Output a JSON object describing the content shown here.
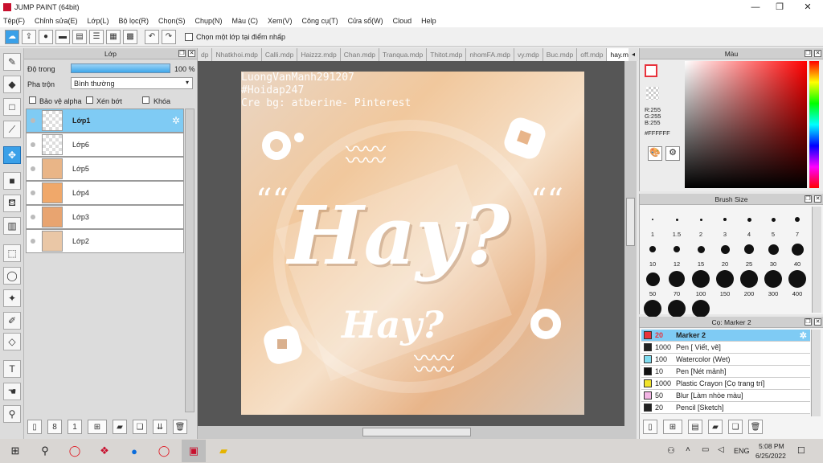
{
  "window": {
    "title": "JUMP PAINT (64bit)",
    "minimize": "—",
    "maximize": "❐",
    "close": "✕"
  },
  "menu": [
    "Tệp(F)",
    "Chỉnh sửa(E)",
    "Lớp(L)",
    "Bộ lọc(R)",
    "Chọn(S)",
    "Chụp(N)",
    "Màu (C)",
    "Xem(V)",
    "Công cụ(T)",
    "Cửa sổ(W)",
    "Cloud",
    "Help"
  ],
  "toolbar": {
    "checkbox_label": "Chọn một lớp tại điểm nhấp"
  },
  "layer_panel": {
    "title": "Lớp",
    "opacity_label": "Độ trong",
    "opacity_value": "100 %",
    "opacity_fraction": 1.0,
    "blend_label": "Pha trộn",
    "blend_value": "Bình thường",
    "protect_alpha": "Bảo vệ alpha",
    "clip": "Xén bớt",
    "lock": "Khóa",
    "layers": [
      {
        "name": "Lớp1",
        "selected": true
      },
      {
        "name": "Lớp6",
        "selected": false
      },
      {
        "name": "Lớp5",
        "selected": false
      },
      {
        "name": "Lớp4",
        "selected": false
      },
      {
        "name": "Lớp3",
        "selected": false
      },
      {
        "name": "Lớp2",
        "selected": false
      }
    ]
  },
  "tabs": [
    "dp",
    "Nhatkhoi.mdp",
    "Calli.mdp",
    "Haizzz.mdp",
    "Chan.mdp",
    "Tranqua.mdp",
    "Thitot.mdp",
    "nhomFA.mdp",
    "vy.mdp",
    "Buc.mdp",
    "off.mdp",
    "hay.mdp"
  ],
  "canvas": {
    "credit_lines": [
      "LuongVanManh291207",
      "#Hoidap247",
      "Cre bg: atberine- Pinterest"
    ],
    "main_text": "Hay?",
    "small_text": "Hay?",
    "quote_mark": "““"
  },
  "color_panel": {
    "title": "Màu",
    "r": "R:255",
    "g": "G:255",
    "b": "B:255",
    "hex": "#FFFFFF"
  },
  "brush_panel": {
    "title": "Brush Size",
    "sizes": [
      "1",
      "1.5",
      "2",
      "3",
      "4",
      "5",
      "7",
      "10",
      "12",
      "15",
      "20",
      "25",
      "30",
      "40",
      "50",
      "70",
      "100",
      "150",
      "200",
      "300",
      "400",
      "",
      "",
      ""
    ]
  },
  "tool_panel": {
    "title": "Cọ: Marker 2",
    "items": [
      {
        "size": "20",
        "name": "Marker 2",
        "color": "#e8323c"
      },
      {
        "size": "1000",
        "name": "Pen [ Viết, vẽ]",
        "color": "#222222"
      },
      {
        "size": "100",
        "name": "Watercolor (Wet)",
        "color": "#7fdcf0"
      },
      {
        "size": "10",
        "name": "Pen [Nét mảnh]",
        "color": "#111111"
      },
      {
        "size": "1000",
        "name": "Plastic Crayon [Cọ trang trí]",
        "color": "#f2e42a"
      },
      {
        "size": "50",
        "name": "Blur [Làm nhòe màu]",
        "color": "#f2b4e4"
      },
      {
        "size": "20",
        "name": "Pencil [Sketch]",
        "color": "#222222"
      }
    ]
  },
  "taskbar": {
    "lang": "ENG",
    "time": "5:08 PM",
    "date": "6/25/2022"
  },
  "colors": {
    "accent": "#3aa0e8",
    "selection": "#7fcbf4"
  }
}
